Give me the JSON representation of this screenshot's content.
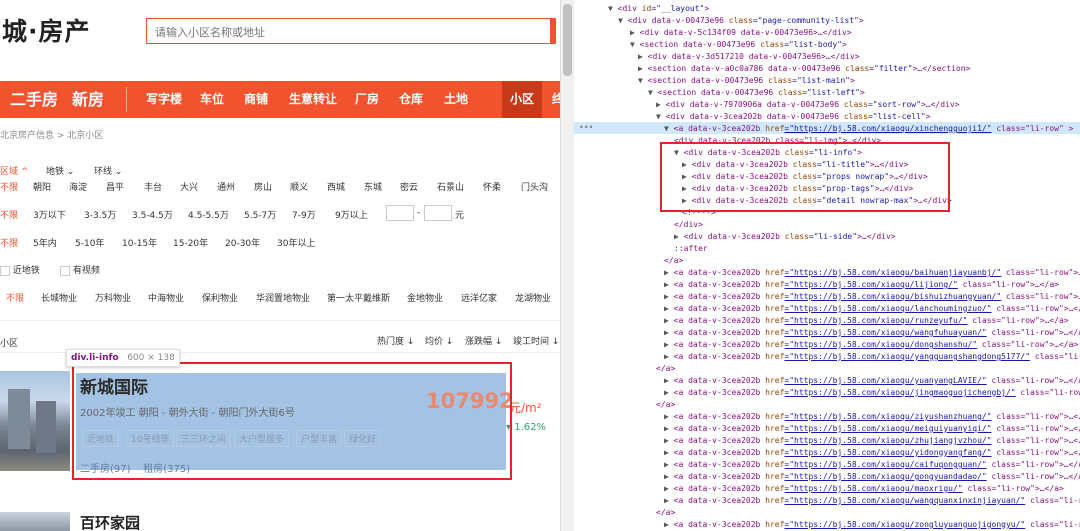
{
  "site": {
    "logo": "城·房产",
    "search_placeholder": "请输入小区名称或地址",
    "nav_main": [
      "二手房",
      "新房"
    ],
    "nav_sub": [
      "写字楼",
      "车位",
      "商铺",
      "生意转让",
      "厂房",
      "仓库",
      "土地"
    ],
    "nav_active": "小区",
    "nav_cut": "终",
    "breadcrumb": "北京房产信息 > 北京小区"
  },
  "filters": {
    "area_tabs": [
      "区域",
      "地铁",
      "环线"
    ],
    "areas": [
      "不限",
      "朝阳",
      "海淀",
      "昌平",
      "丰台",
      "大兴",
      "通州",
      "房山",
      "顺义",
      "西城",
      "东城",
      "密云",
      "石景山",
      "怀柔",
      "门头沟"
    ],
    "price": [
      "不限",
      "3万以下",
      "3-3.5万",
      "3.5-4.5万",
      "4.5-5.5万",
      "5.5-7万",
      "7-9万",
      "9万以上"
    ],
    "price_dash": "-",
    "price_unit": "元",
    "age": [
      "不限",
      "5年内",
      "5-10年",
      "10-15年",
      "15-20年",
      "20-30年",
      "30年以上"
    ],
    "checks": [
      "近地铁",
      "有视频"
    ],
    "developers": [
      "不限",
      "长城物业",
      "万科物业",
      "中海物业",
      "保利物业",
      "华润置地物业",
      "第一太平戴维斯",
      "金地物业",
      "远洋亿家",
      "龙湖物业"
    ]
  },
  "list": {
    "label": "小区",
    "sort": [
      "热门度",
      "均价",
      "涨跌幅",
      "竣工时间"
    ]
  },
  "tooltip": {
    "tag": "div.li-info",
    "size": "600 × 138"
  },
  "card": {
    "title": "新城国际",
    "props": "2002年竣工   朝阳 - 朝外大街 - 朝阳门外大街6号",
    "tags": [
      "近地铁",
      "10号线等",
      "三三环之间",
      "大户型居多",
      "户型丰富",
      "绿化好"
    ],
    "detail": [
      "二手房(97)",
      "租房(375)"
    ],
    "price": "107992",
    "unit": "元/m²",
    "change": "1.62%"
  },
  "card2": {
    "title": "百环家园"
  },
  "devtools": {
    "lines": [
      [
        "▼",
        "<div ",
        "id",
        "=\"__layout\"",
        ">"
      ],
      [
        "▼",
        "<div data-v-00473e96 ",
        "class",
        "=\"page-community-list\"",
        ">"
      ],
      [
        "▶",
        "<div data-v-5c134f09 data-v-00473e96>",
        "",
        "",
        "…</div>"
      ],
      [
        "▼",
        "<section data-v-00473e96 ",
        "class",
        "=\"list-body\"",
        ">"
      ],
      [
        "▶",
        "<div data-v-3d517210 data-v-00473e96>",
        "",
        "",
        "…</div>"
      ],
      [
        "▶",
        "<section data-v-a0c0a786 data-v-00473e96 ",
        "class",
        "=\"filter\"",
        ">…</section>"
      ],
      [
        "▼",
        "<section data-v-00473e96 ",
        "class",
        "=\"list-main\"",
        ">"
      ],
      [
        "▼",
        "<section data-v-00473e96 ",
        "class",
        "=\"list-left\"",
        ">"
      ],
      [
        "▶",
        "<div data-v-7970906a data-v-00473e96 ",
        "class",
        "=\"sort-row\"",
        ">…</div>"
      ],
      [
        "▼",
        "<div data-v-3cea202b data-v-00473e96 ",
        "class",
        "=\"list-cell\"",
        ">"
      ],
      [
        "▼",
        "<a data-v-3cea202b ",
        "href",
        "=\"https://bj.58.com/xiaoqu/xinchengguoji1/\"",
        " class=\"li-row\" >"
      ],
      [
        "",
        "<div data-v-3cea202b class=\"li-img\">…</div>",
        "",
        "",
        ""
      ],
      [
        "▼",
        "<div data-v-3cea202b ",
        "class",
        "=\"li-info\"",
        ">"
      ],
      [
        "▶",
        "<div data-v-3cea202b ",
        "class",
        "=\"li-title\"",
        ">…</div>"
      ],
      [
        "▶",
        "<div data-v-3cea202b ",
        "class",
        "=\"props nowrap\"",
        ">…</div>"
      ],
      [
        "▶",
        "<div data-v-3cea202b ",
        "class",
        "=\"prop-tags\"",
        ">…</div>"
      ],
      [
        "▶",
        "<div data-v-3cea202b ",
        "class",
        "=\"detail nowrap-max\"",
        ">…</div>"
      ],
      [
        "",
        "<!---->",
        "",
        "",
        ""
      ],
      [
        "",
        "</div>",
        "",
        "",
        ""
      ],
      [
        "▶",
        "<div data-v-3cea202b ",
        "class",
        "=\"li-side\"",
        ">…</div>"
      ],
      [
        "",
        "::after",
        "",
        "",
        ""
      ],
      [
        "",
        "</a>",
        "",
        "",
        ""
      ],
      [
        "▶",
        "<a data-v-3cea202b ",
        "href",
        "=\"https://bj.58.com/xiaoqu/baihuanjiayuanbj/\"",
        " class=\"li-row\">…</a>"
      ],
      [
        "▶",
        "<a data-v-3cea202b ",
        "href",
        "=\"https://bj.58.com/xiaoqu/lijiong/\"",
        " class=\"li-row\">…</a>"
      ],
      [
        "▶",
        "<a data-v-3cea202b ",
        "href",
        "=\"https://bj.58.com/xiaoqu/bishuizhuangyuan/\"",
        " class=\"li-row\">…</a>"
      ],
      [
        "▶",
        "<a data-v-3cea202b ",
        "href",
        "=\"https://bj.58.com/xiaoqu/lanchoumingzuo/\"",
        " class=\"li-row\">…</a>"
      ],
      [
        "▶",
        "<a data-v-3cea202b ",
        "href",
        "=\"https://bj.58.com/xiaoqu/runzeyufu/\"",
        " class=\"li-row\">…</a>"
      ],
      [
        "▶",
        "<a data-v-3cea202b ",
        "href",
        "=\"https://bj.58.com/xiaoqu/wangfuhuayuan/\"",
        " class=\"li-row\">…</a>"
      ],
      [
        "▶",
        "<a data-v-3cea202b ",
        "href",
        "=\"https://bj.58.com/xiaoqu/dongshanshu/\"",
        " class=\"li-row\">…</a>"
      ],
      [
        "▶",
        "<a data-v-3cea202b ",
        "href",
        "=\"https://bj.58.com/xiaoqu/yangguangshangdong5177/\"",
        " class=\"li-row\">…</a>"
      ],
      [
        "",
        "</a>",
        "",
        "",
        ""
      ],
      [
        "▶",
        "<a data-v-3cea202b ",
        "href",
        "=\"https://bj.58.com/xiaoqu/yuanyangLAVIE/\"",
        " class=\"li-row\">…</a>"
      ],
      [
        "▶",
        "<a data-v-3cea202b ",
        "href",
        "=\"https://bj.58.com/xiaoqu/jingmaoguojichengbj/\"",
        " class=\"li-row\">…</a>"
      ],
      [
        "",
        "</a>",
        "",
        "",
        ""
      ],
      [
        "▶",
        "<a data-v-3cea202b ",
        "href",
        "=\"https://bj.58.com/xiaoqu/ziyushanzhuang/\"",
        " class=\"li-row\">…</a>"
      ],
      [
        "▶",
        "<a data-v-3cea202b ",
        "href",
        "=\"https://bj.58.com/xiaoqu/meiguiyuanyiqi/\"",
        " class=\"li-row\">…</a>"
      ],
      [
        "▶",
        "<a data-v-3cea202b ",
        "href",
        "=\"https://bj.58.com/xiaoqu/zhujiangjvzhou/\"",
        " class=\"li-row\">…</a>"
      ],
      [
        "▶",
        "<a data-v-3cea202b ",
        "href",
        "=\"https://bj.58.com/xiaoqu/yidongyangfang/\"",
        " class=\"li-row\">…</a>"
      ],
      [
        "▶",
        "<a data-v-3cea202b ",
        "href",
        "=\"https://bj.58.com/xiaoqu/caifuqongguan/\"",
        " class=\"li-row\">…</a>"
      ],
      [
        "▶",
        "<a data-v-3cea202b ",
        "href",
        "=\"https://bj.58.com/xiaoqu/gongyuandadao/\"",
        " class=\"li-row\">…</a>"
      ],
      [
        "▶",
        "<a data-v-3cea202b ",
        "href",
        "=\"https://bj.58.com/xiaoqu/maoxrigu/\"",
        " class=\"li-row\">…</a>"
      ],
      [
        "▶",
        "<a data-v-3cea202b ",
        "href",
        "=\"https://bj.58.com/xiaoqu/wangquanxinxinjiayuan/\"",
        " class=\"li-row\">…</a>"
      ],
      [
        "",
        "</a>",
        "",
        "",
        ""
      ],
      [
        "▶",
        "<a data-v-3cea202b ",
        "href",
        "=\"https://bj.58.com/xiaoqu/zongluyuanguojigongyu/\"",
        " class=\"li-row\">…</a>"
      ]
    ]
  },
  "colors": {
    "brand": "#f0532e",
    "highlight": "#a4c3e4",
    "annotation": "#e0252b"
  }
}
